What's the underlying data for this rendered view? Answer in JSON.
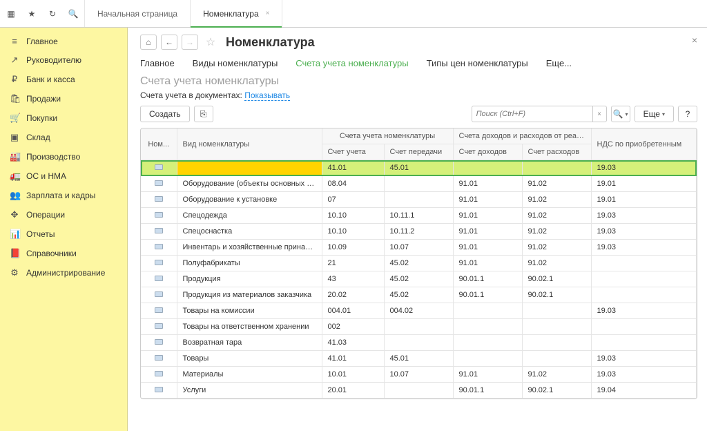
{
  "topTabs": [
    {
      "label": "Начальная страница",
      "active": false
    },
    {
      "label": "Номенклатура",
      "active": true,
      "closable": true
    }
  ],
  "sidebar": [
    {
      "icon": "≡",
      "label": "Главное"
    },
    {
      "icon": "↗",
      "label": "Руководителю"
    },
    {
      "icon": "₽",
      "label": "Банк и касса"
    },
    {
      "icon": "🛍",
      "label": "Продажи"
    },
    {
      "icon": "🛒",
      "label": "Покупки"
    },
    {
      "icon": "▣",
      "label": "Склад"
    },
    {
      "icon": "🏭",
      "label": "Производство"
    },
    {
      "icon": "🚛",
      "label": "ОС и НМА"
    },
    {
      "icon": "👥",
      "label": "Зарплата и кадры"
    },
    {
      "icon": "✥",
      "label": "Операции"
    },
    {
      "icon": "📊",
      "label": "Отчеты"
    },
    {
      "icon": "📕",
      "label": "Справочники"
    },
    {
      "icon": "⚙",
      "label": "Администрирование"
    }
  ],
  "pageTitle": "Номенклатура",
  "secondaryTabs": [
    {
      "label": "Главное",
      "active": false
    },
    {
      "label": "Виды номенклатуры",
      "active": false
    },
    {
      "label": "Счета учета номенклатуры",
      "active": true
    },
    {
      "label": "Типы цен номенклатуры",
      "active": false
    },
    {
      "label": "Еще...",
      "active": false
    }
  ],
  "subtitle": "Счета учета номенклатуры",
  "docLine": {
    "prefix": "Счета учета в документах: ",
    "link": "Показывать"
  },
  "toolbar": {
    "create": "Создать",
    "more": "Еще",
    "searchPlaceholder": "Поиск (Ctrl+F)"
  },
  "columns": {
    "nom": "Ном...",
    "kind": "Вид номенклатуры",
    "accGroup": "Счета учета номенклатуры",
    "incGroup": "Счета доходов и расходов от реализации",
    "acc": "Счет учета",
    "transfer": "Счет передачи",
    "income": "Счет доходов",
    "expense": "Счет расходов",
    "vat": "НДС по приобретенным"
  },
  "rows": [
    {
      "selected": true,
      "name": "",
      "acc": "41.01",
      "transfer": "45.01",
      "income": "",
      "expense": "",
      "vat": "19.03"
    },
    {
      "name": "Оборудование (объекты основных с...",
      "acc": "08.04",
      "transfer": "",
      "income": "91.01",
      "expense": "91.02",
      "vat": "19.01"
    },
    {
      "name": "Оборудование к установке",
      "acc": "07",
      "transfer": "",
      "income": "91.01",
      "expense": "91.02",
      "vat": "19.01"
    },
    {
      "name": "Спецодежда",
      "acc": "10.10",
      "transfer": "10.11.1",
      "income": "91.01",
      "expense": "91.02",
      "vat": "19.03"
    },
    {
      "name": "Спецоснастка",
      "acc": "10.10",
      "transfer": "10.11.2",
      "income": "91.01",
      "expense": "91.02",
      "vat": "19.03"
    },
    {
      "name": "Инвентарь и хозяйственные принадл...",
      "acc": "10.09",
      "transfer": "10.07",
      "income": "91.01",
      "expense": "91.02",
      "vat": "19.03"
    },
    {
      "name": "Полуфабрикаты",
      "acc": "21",
      "transfer": "45.02",
      "income": "91.01",
      "expense": "91.02",
      "vat": ""
    },
    {
      "name": "Продукция",
      "acc": "43",
      "transfer": "45.02",
      "income": "90.01.1",
      "expense": "90.02.1",
      "vat": ""
    },
    {
      "name": "Продукция из материалов заказчика",
      "acc": "20.02",
      "transfer": "45.02",
      "income": "90.01.1",
      "expense": "90.02.1",
      "vat": ""
    },
    {
      "name": "Товары на комиссии",
      "acc": "004.01",
      "transfer": "004.02",
      "income": "",
      "expense": "",
      "vat": "19.03"
    },
    {
      "name": "Товары на ответственном хранении",
      "acc": "002",
      "transfer": "",
      "income": "",
      "expense": "",
      "vat": ""
    },
    {
      "name": "Возвратная тара",
      "acc": "41.03",
      "transfer": "",
      "income": "",
      "expense": "",
      "vat": ""
    },
    {
      "name": "Товары",
      "acc": "41.01",
      "transfer": "45.01",
      "income": "",
      "expense": "",
      "vat": "19.03"
    },
    {
      "name": "Материалы",
      "acc": "10.01",
      "transfer": "10.07",
      "income": "91.01",
      "expense": "91.02",
      "vat": "19.03"
    },
    {
      "name": "Услуги",
      "acc": "20.01",
      "transfer": "",
      "income": "90.01.1",
      "expense": "90.02.1",
      "vat": "19.04"
    }
  ]
}
